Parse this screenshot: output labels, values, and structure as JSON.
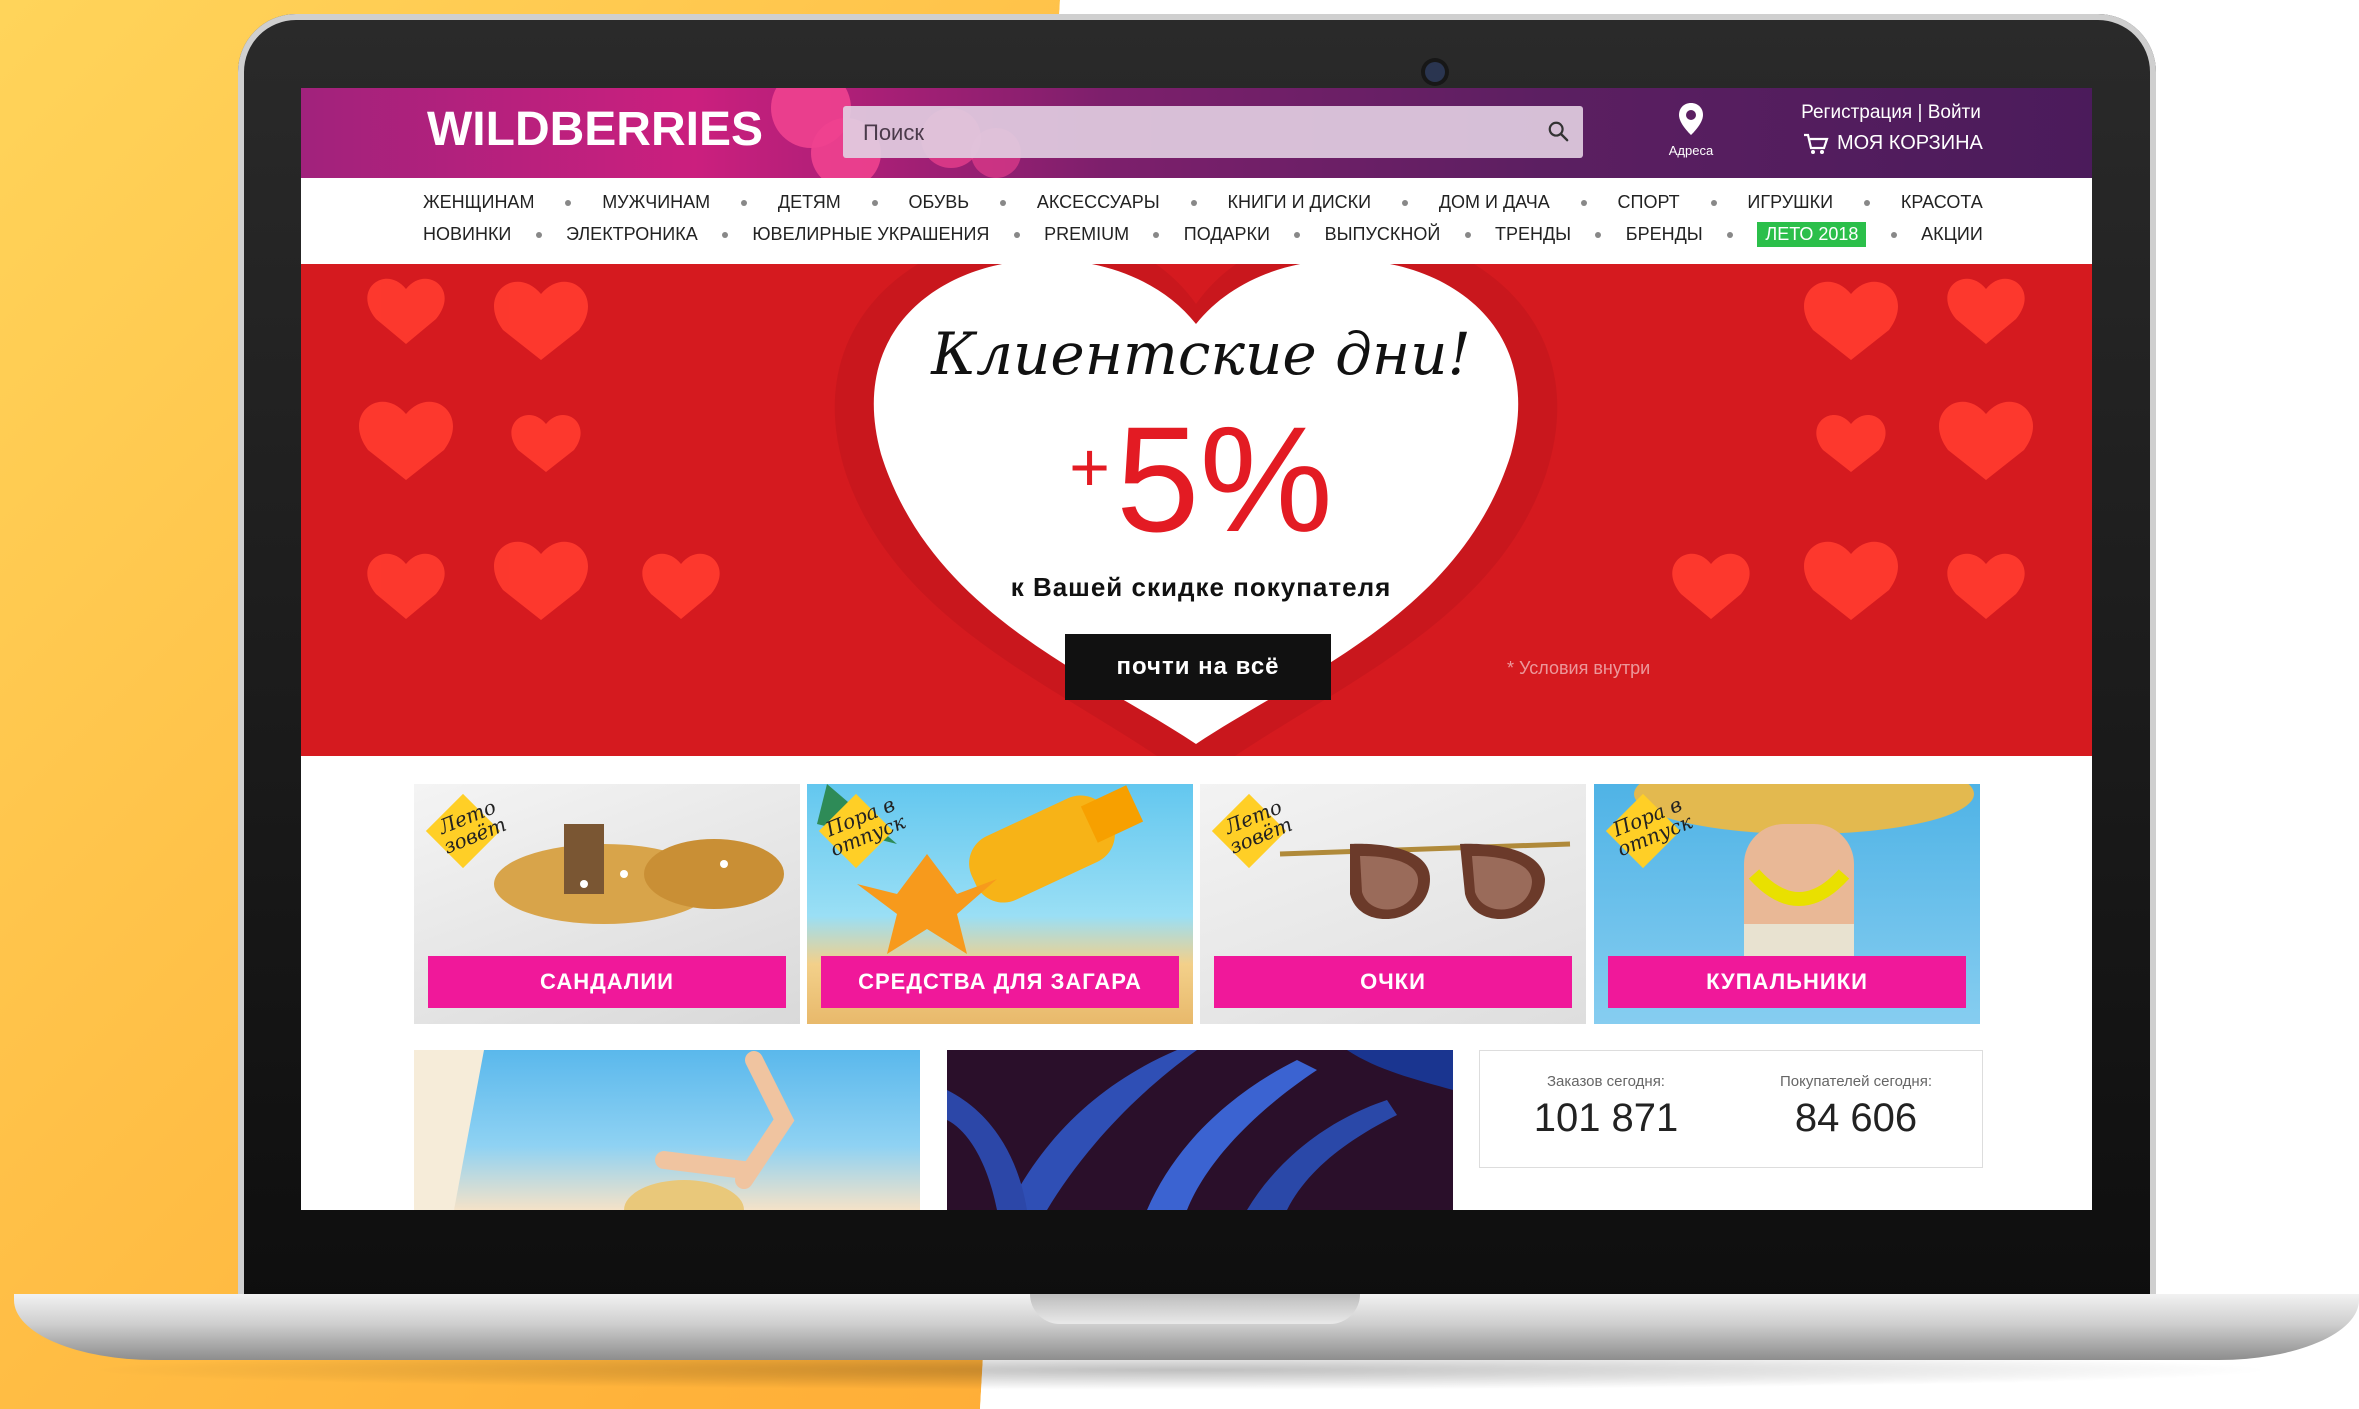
{
  "header": {
    "logo": "WILDBERRIES",
    "search_placeholder": "Поиск",
    "address_label": "Адреса",
    "auth_register": "Регистрация",
    "auth_separator": "|",
    "auth_login": "Войти",
    "cart_label": "МОЯ КОРЗИНА"
  },
  "nav": {
    "row1": [
      "ЖЕНЩИНАМ",
      "МУЖЧИНАМ",
      "ДЕТЯМ",
      "ОБУВЬ",
      "АКСЕССУАРЫ",
      "КНИГИ И ДИСКИ",
      "ДОМ И ДАЧА",
      "СПОРТ",
      "ИГРУШКИ",
      "КРАСОТА"
    ],
    "row2": [
      "НОВИНКИ",
      "ЭЛЕКТРОНИКА",
      "ЮВЕЛИРНЫЕ УКРАШЕНИЯ",
      "PREMIUM",
      "ПОДАРКИ",
      "ВЫПУСКНОЙ",
      "ТРЕНДЫ",
      "БРЕНДЫ",
      "ЛЕТО 2018",
      "АКЦИИ"
    ],
    "highlight_color": "#2bbf4a"
  },
  "hero": {
    "title": "Клиентские дни!",
    "plus": "+",
    "percent": "5%",
    "subtitle": "к Вашей скидке покупателя",
    "button": "почти на всё",
    "note": "* Условия внутри",
    "bg_color": "#d51a1f",
    "accent": "#e31b23"
  },
  "categories": [
    {
      "label": "САНДАЛИИ",
      "tag": "Лето зовёт"
    },
    {
      "label": "СРЕДСТВА ДЛЯ ЗАГАРА",
      "tag": "Пора в отпуск"
    },
    {
      "label": "ОЧКИ",
      "tag": "Лето зовёт"
    },
    {
      "label": "КУПАЛЬНИКИ",
      "tag": "Пора в отпуск"
    }
  ],
  "stats": {
    "orders_label": "Заказов сегодня:",
    "orders_value": "101 871",
    "buyers_label": "Покупателей сегодня:",
    "buyers_value": "84 606"
  },
  "colors": {
    "brand_purple": "#5b1f61",
    "brand_pink": "#cb1f7e",
    "category_banner": "#f0189a"
  }
}
